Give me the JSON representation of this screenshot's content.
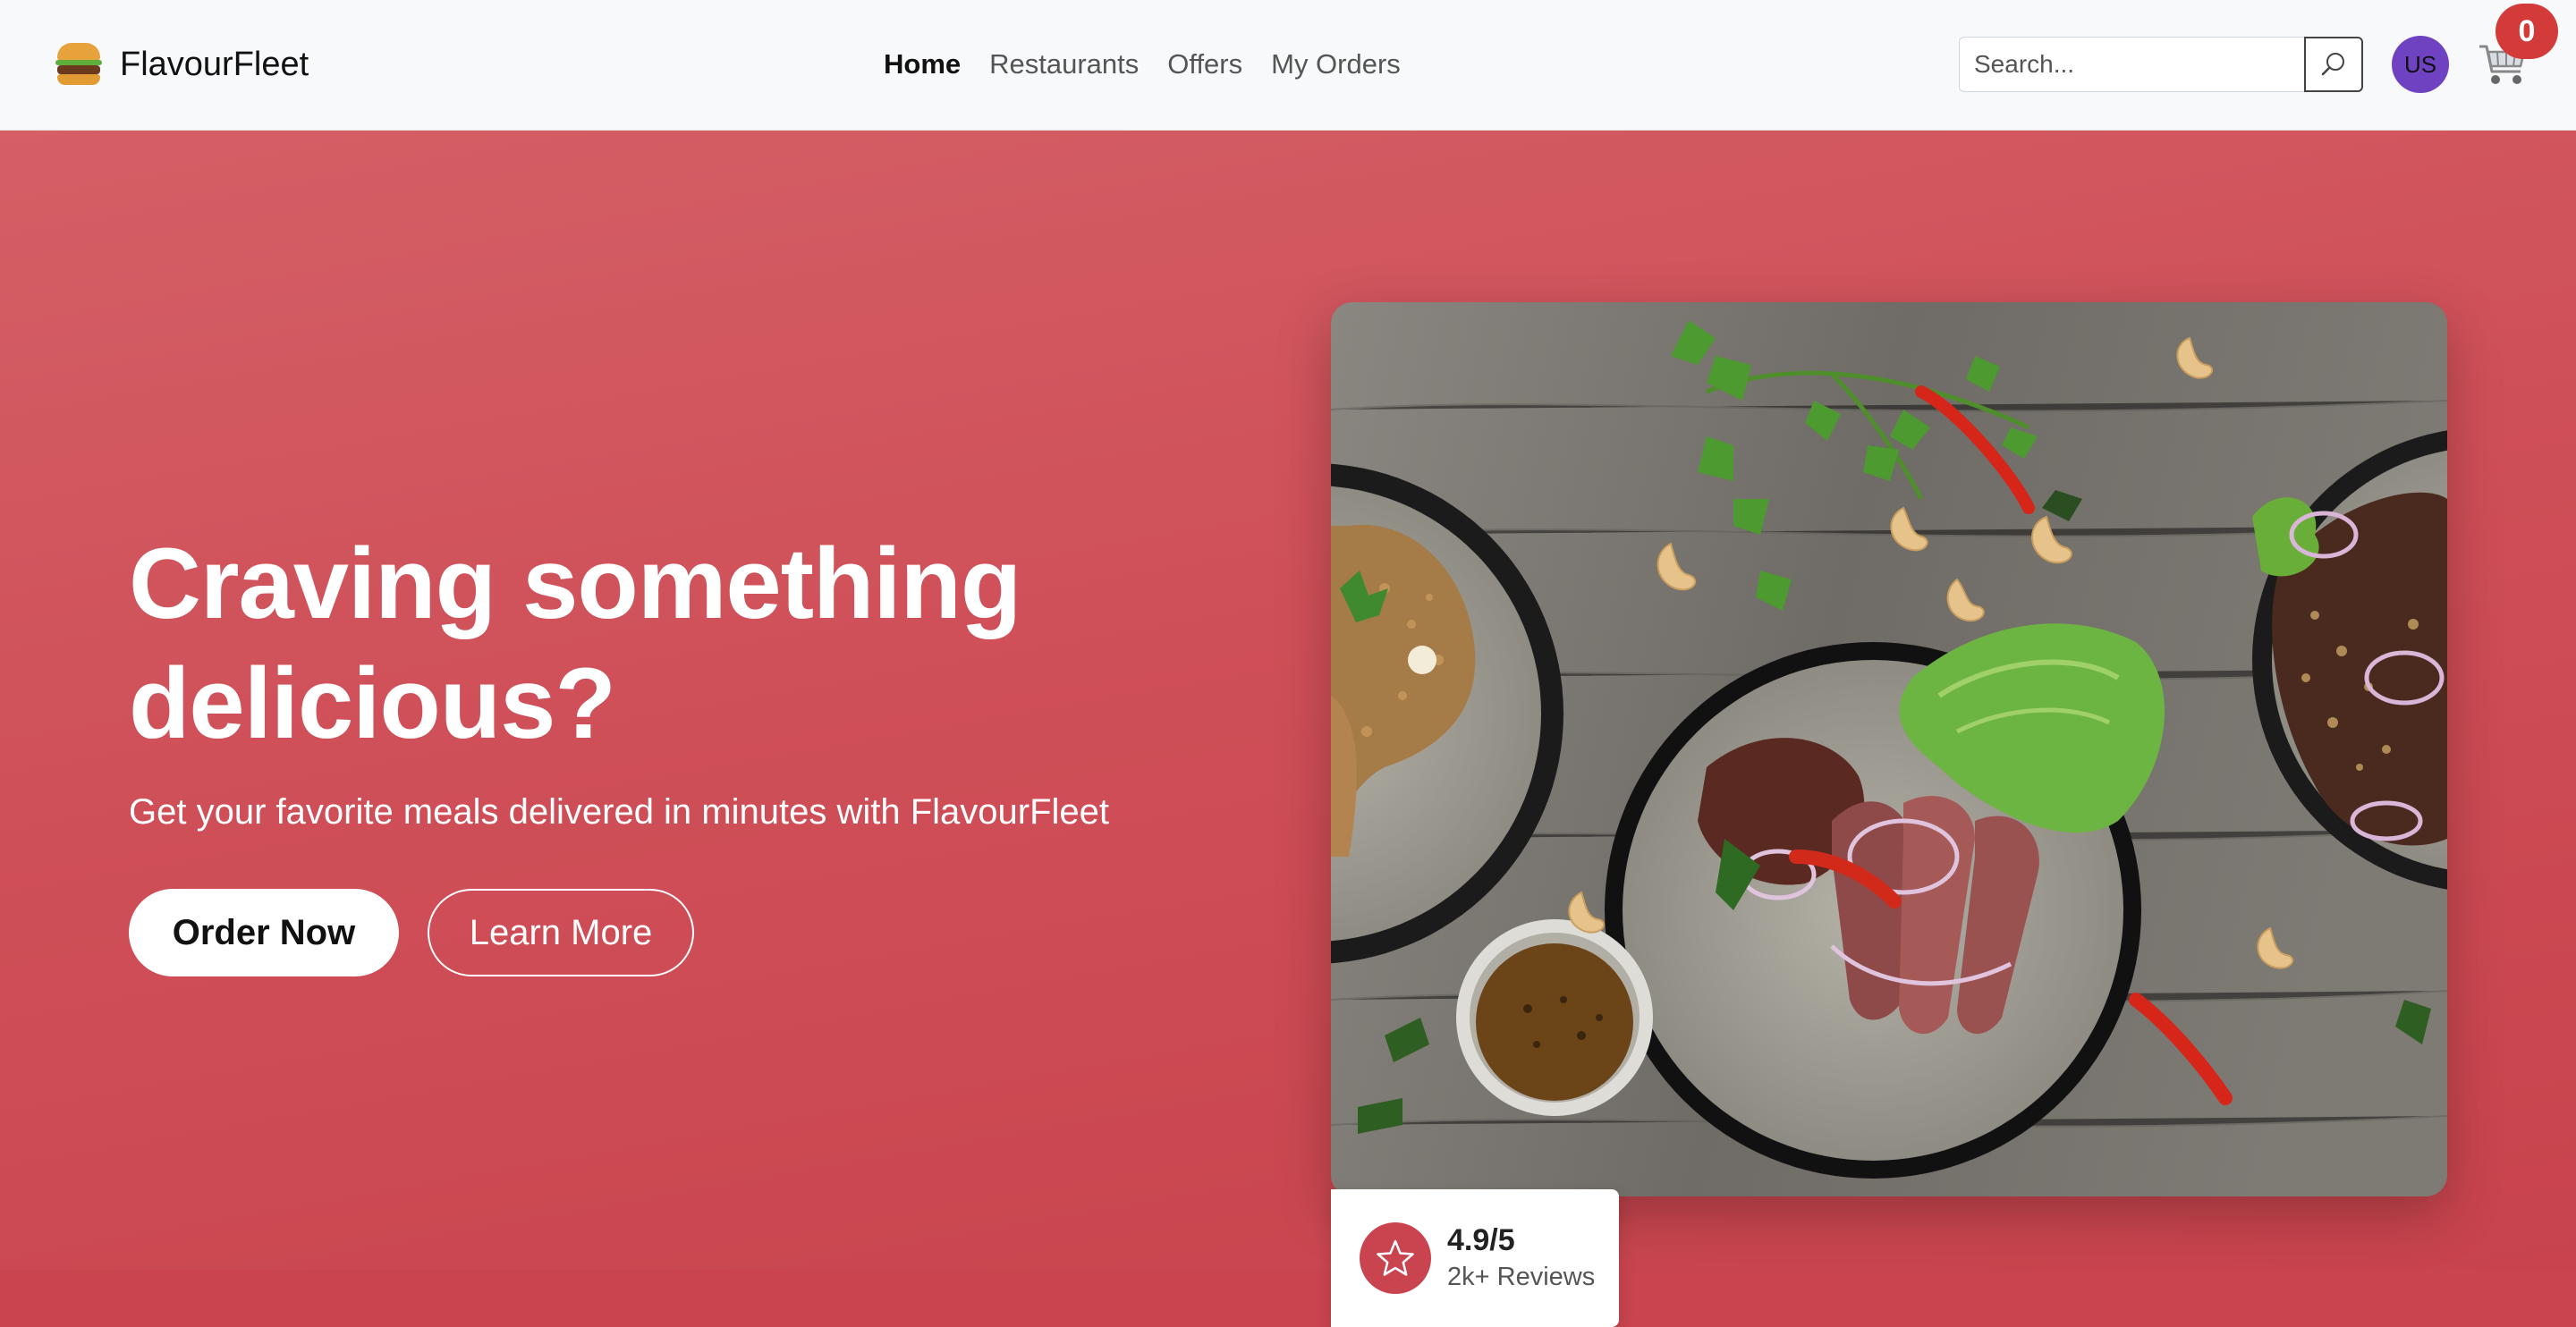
{
  "brand": {
    "name": "FlavourFleet",
    "logo_icon": "burger-icon"
  },
  "nav": {
    "links": [
      {
        "label": "Home",
        "active": true
      },
      {
        "label": "Restaurants",
        "active": false
      },
      {
        "label": "Offers",
        "active": false
      },
      {
        "label": "My Orders",
        "active": false
      }
    ]
  },
  "search": {
    "placeholder": "Search...",
    "value": "",
    "button_icon": "search-icon"
  },
  "user": {
    "initials": "US",
    "avatar_color": "#6f42c1"
  },
  "cart": {
    "icon": "cart-icon",
    "count": "0",
    "badge_color": "#d33a3a"
  },
  "hero": {
    "title": "Craving something delicious?",
    "subtitle": "Get your favorite meals delivered in minutes with FlavourFleet",
    "primary_button": "Order Now",
    "secondary_button": "Learn More",
    "background_color": "#cf4f58"
  },
  "rating": {
    "icon": "star-icon",
    "value": "4.9/5",
    "label": "2k+ Reviews"
  }
}
